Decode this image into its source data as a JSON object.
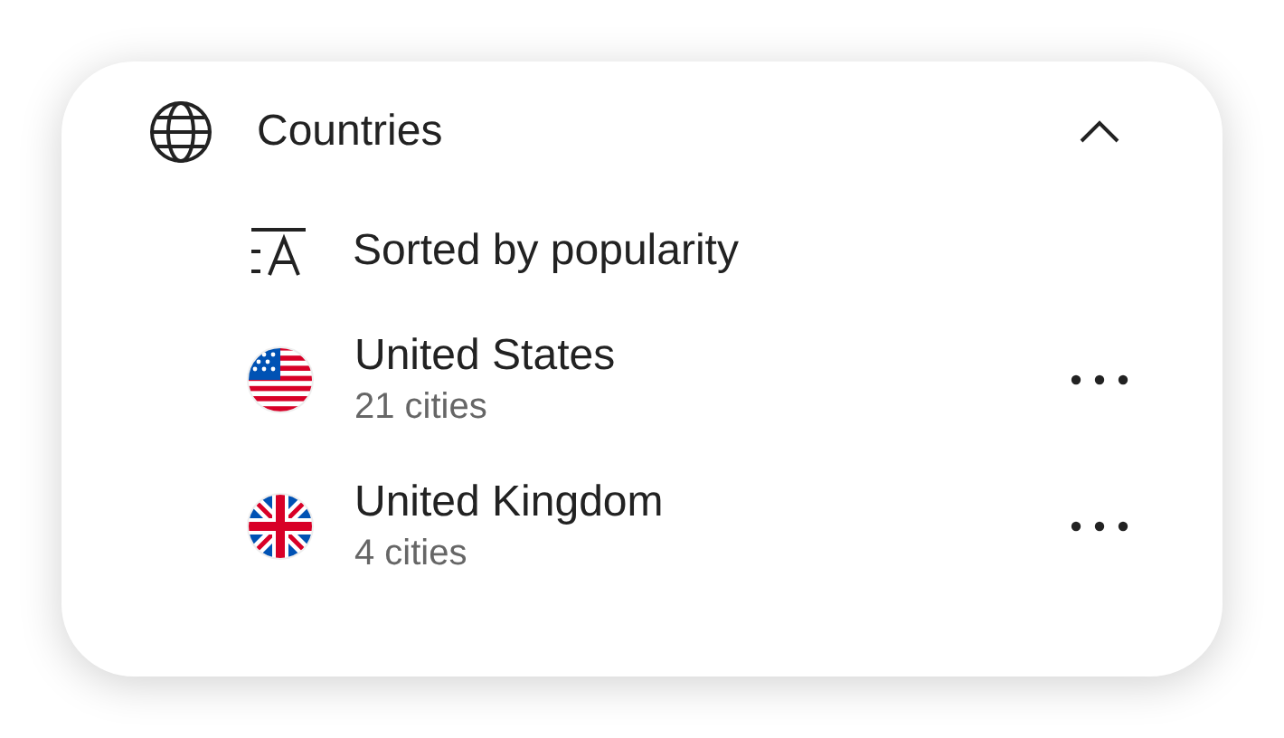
{
  "section": {
    "title": "Countries",
    "expanded": true
  },
  "sort": {
    "label": "Sorted by popularity"
  },
  "countries": [
    {
      "kind": "us",
      "name": "United States",
      "count": "21 cities"
    },
    {
      "kind": "gb",
      "name": "United Kingdom",
      "count": "4 cities"
    }
  ]
}
